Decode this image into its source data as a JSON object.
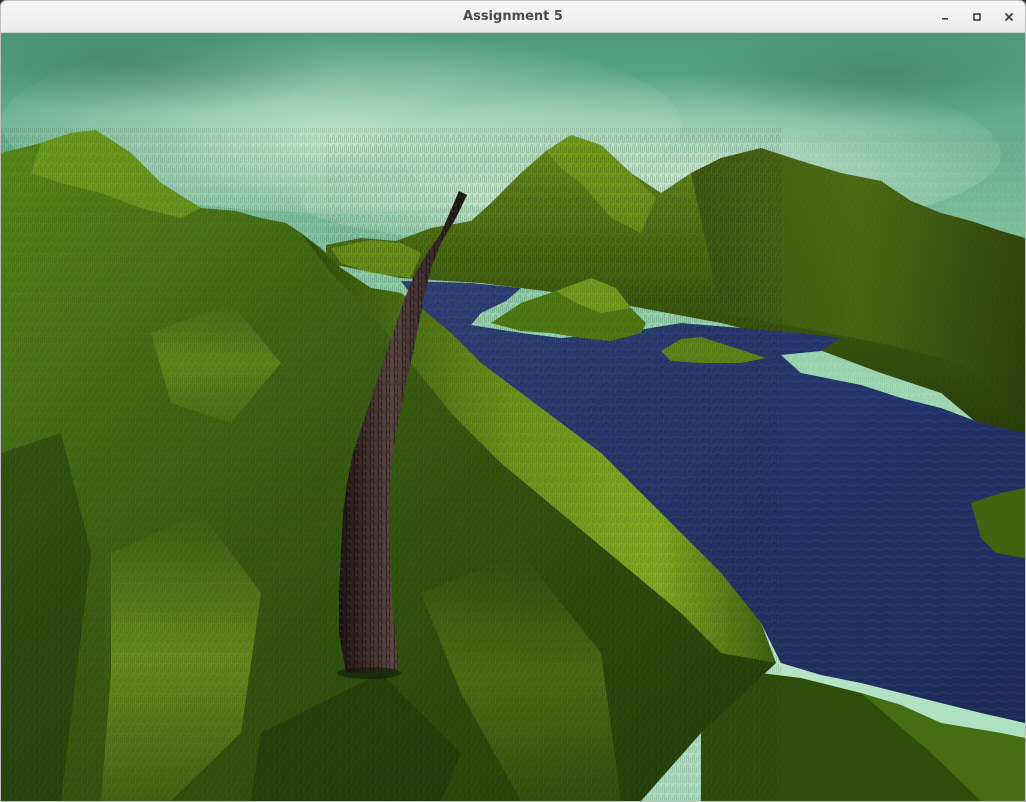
{
  "window": {
    "title": "Assignment 5",
    "controls": {
      "minimize_icon": "minimize-icon",
      "maximize_icon": "maximize-icon",
      "close_icon": "close-icon"
    }
  },
  "scene": {
    "sky_colors": [
      "#4f9a7e",
      "#8fd2ad",
      "#c0e8c8",
      "#a8ddc0"
    ],
    "grass_colors": [
      "#1f3a05",
      "#3d6510",
      "#5f8f17",
      "#8ab522"
    ],
    "water_colors": [
      "#1b2a55",
      "#22346a",
      "#2d3f78"
    ],
    "trunk_colors": [
      "#1c1414",
      "#3a2c2a",
      "#5a4440"
    ]
  }
}
